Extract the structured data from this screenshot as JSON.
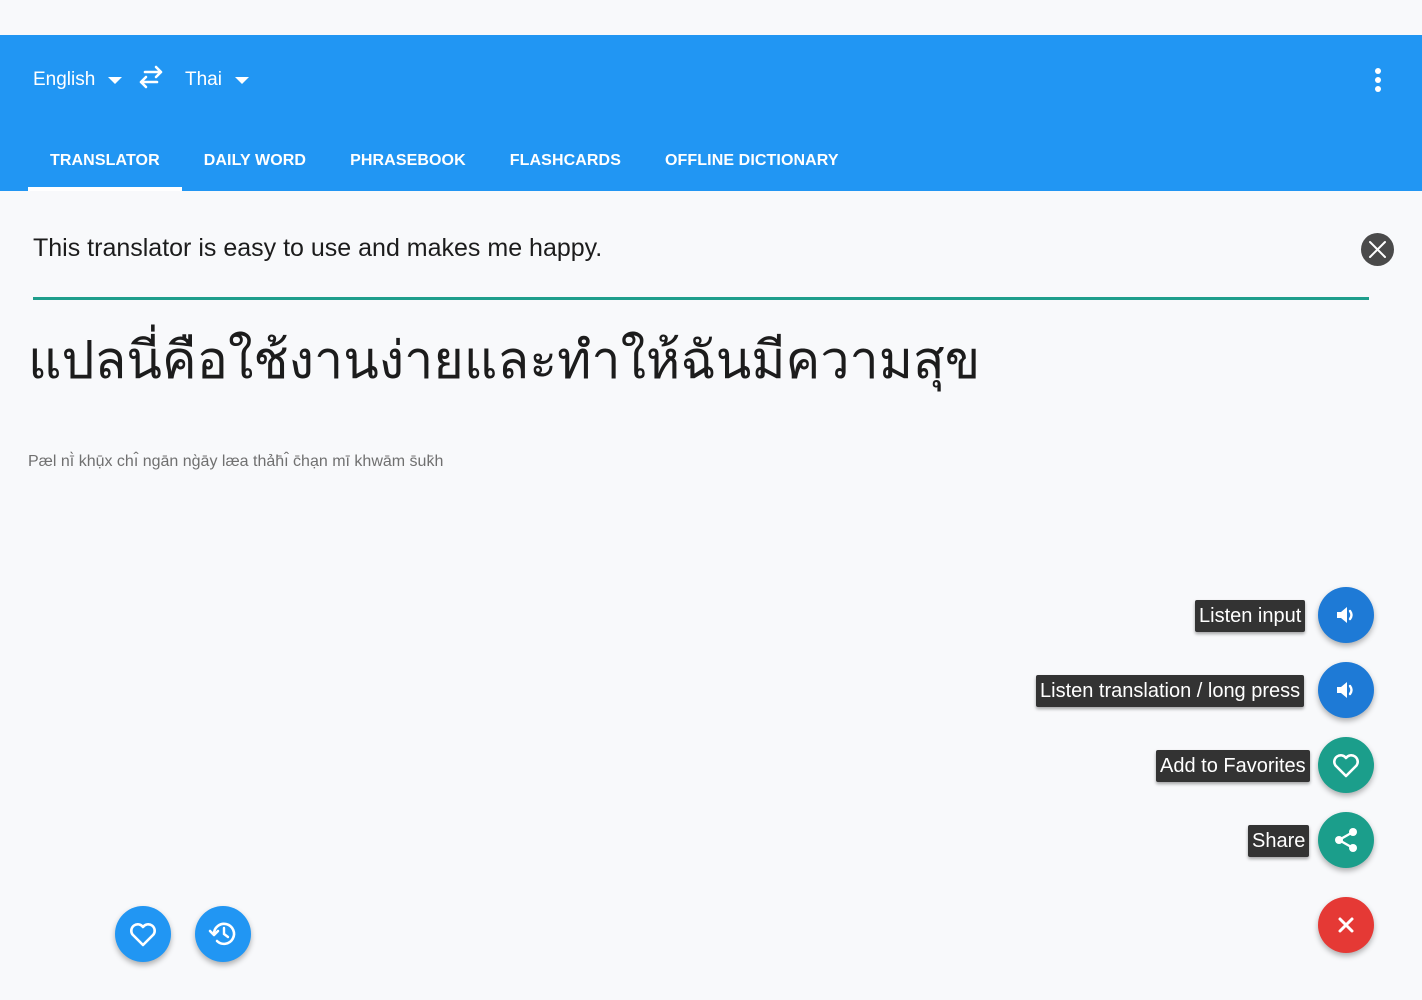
{
  "header": {
    "source_language": "English",
    "target_language": "Thai",
    "icons": {
      "swap": "swap-icon",
      "more": "more-vert-icon"
    }
  },
  "tabs": [
    {
      "label": "TRANSLATOR",
      "active": true
    },
    {
      "label": "DAILY WORD",
      "active": false
    },
    {
      "label": "PHRASEBOOK",
      "active": false
    },
    {
      "label": "FLASHCARDS",
      "active": false
    },
    {
      "label": "OFFLINE DICTIONARY",
      "active": false
    }
  ],
  "translator": {
    "input_text": "This translator is easy to use and makes me happy.",
    "translation": "แปลนี่คือใช้งานง่ายและทำให้ฉันมีความสุข",
    "transliteration": "Pæl nī̀ khụ̄x chı̂ ngān ng̀āy læa thảh̄ı̂ c̄hạn mī khwām s̄uk̄h"
  },
  "actions": {
    "listen_input": "Listen input",
    "listen_translation": "Listen translation / long press",
    "add_favorites": "Add to Favorites",
    "share": "Share"
  },
  "colors": {
    "accent": "#2196f3",
    "teal": "#1b9e8b",
    "red": "#e53935",
    "fab_blue": "#1e7ad6"
  }
}
